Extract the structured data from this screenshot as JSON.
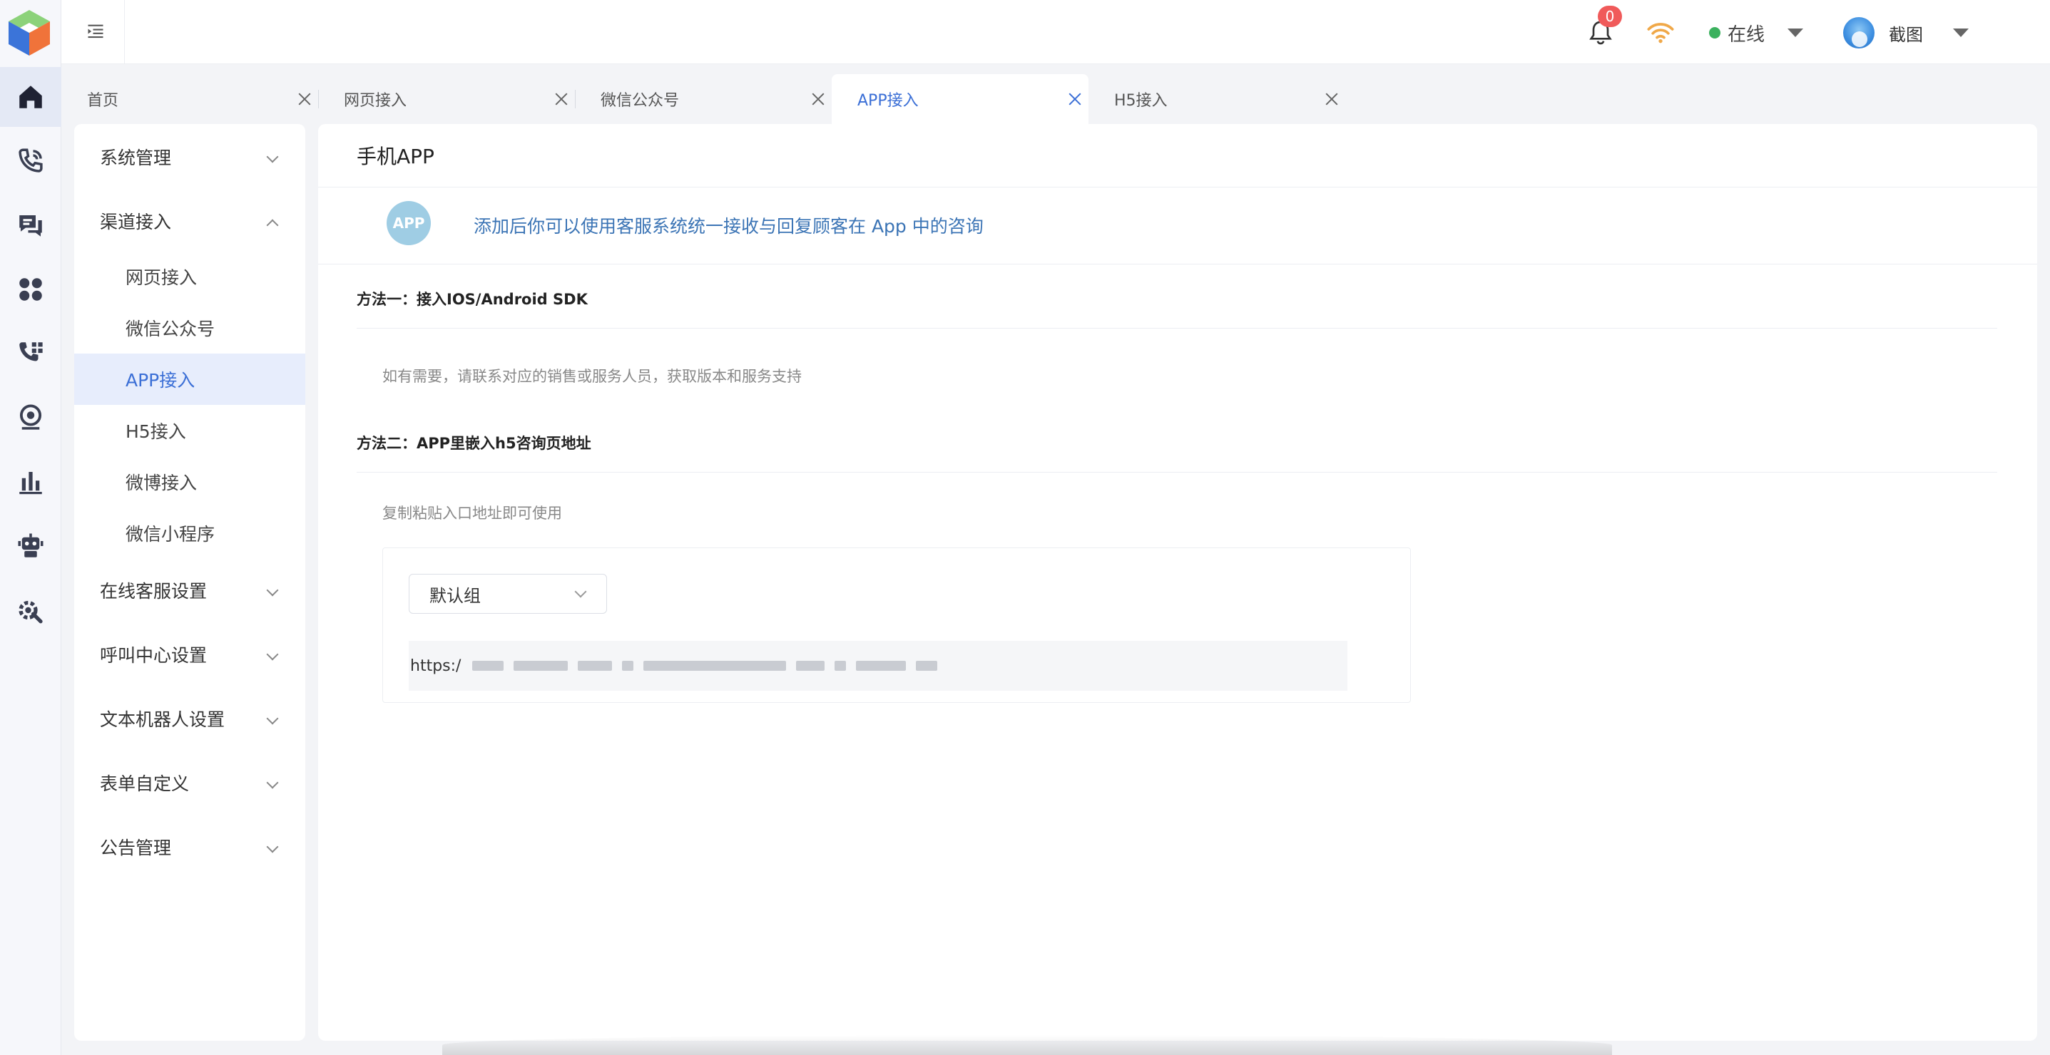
{
  "header": {
    "notification_count": "0",
    "status_label": "在线",
    "user_label": "截图"
  },
  "tabs": [
    {
      "label": "首页"
    },
    {
      "label": "网页接入"
    },
    {
      "label": "微信公众号"
    },
    {
      "label": "APP接入"
    },
    {
      "label": "H5接入"
    }
  ],
  "menu": {
    "groups": [
      {
        "label": "系统管理"
      },
      {
        "label": "渠道接入"
      },
      {
        "label": "在线客服设置"
      },
      {
        "label": "呼叫中心设置"
      },
      {
        "label": "文本机器人设置"
      },
      {
        "label": "表单自定义"
      },
      {
        "label": "公告管理"
      }
    ],
    "channel_items": [
      {
        "label": "网页接入"
      },
      {
        "label": "微信公众号"
      },
      {
        "label": "APP接入"
      },
      {
        "label": "H5接入"
      },
      {
        "label": "微博接入"
      },
      {
        "label": "微信小程序"
      }
    ]
  },
  "content": {
    "title": "手机APP",
    "badge": "APP",
    "intro": "添加后你可以使用客服系统统一接收与回复顾客在 App 中的咨询",
    "method1_title": "方法一：接入IOS/Android SDK",
    "method1_hint": "如有需要，请联系对应的销售或服务人员，获取版本和服务支持",
    "method2_title": "方法二：APP里嵌入h5咨询页地址",
    "method2_hint": "复制粘贴入口地址即可使用",
    "group_select": "默认组",
    "url_prefix": "https:/"
  },
  "colors": {
    "accent": "#3b6fd6",
    "online": "#3bb15e",
    "badge": "#f05a5a"
  }
}
